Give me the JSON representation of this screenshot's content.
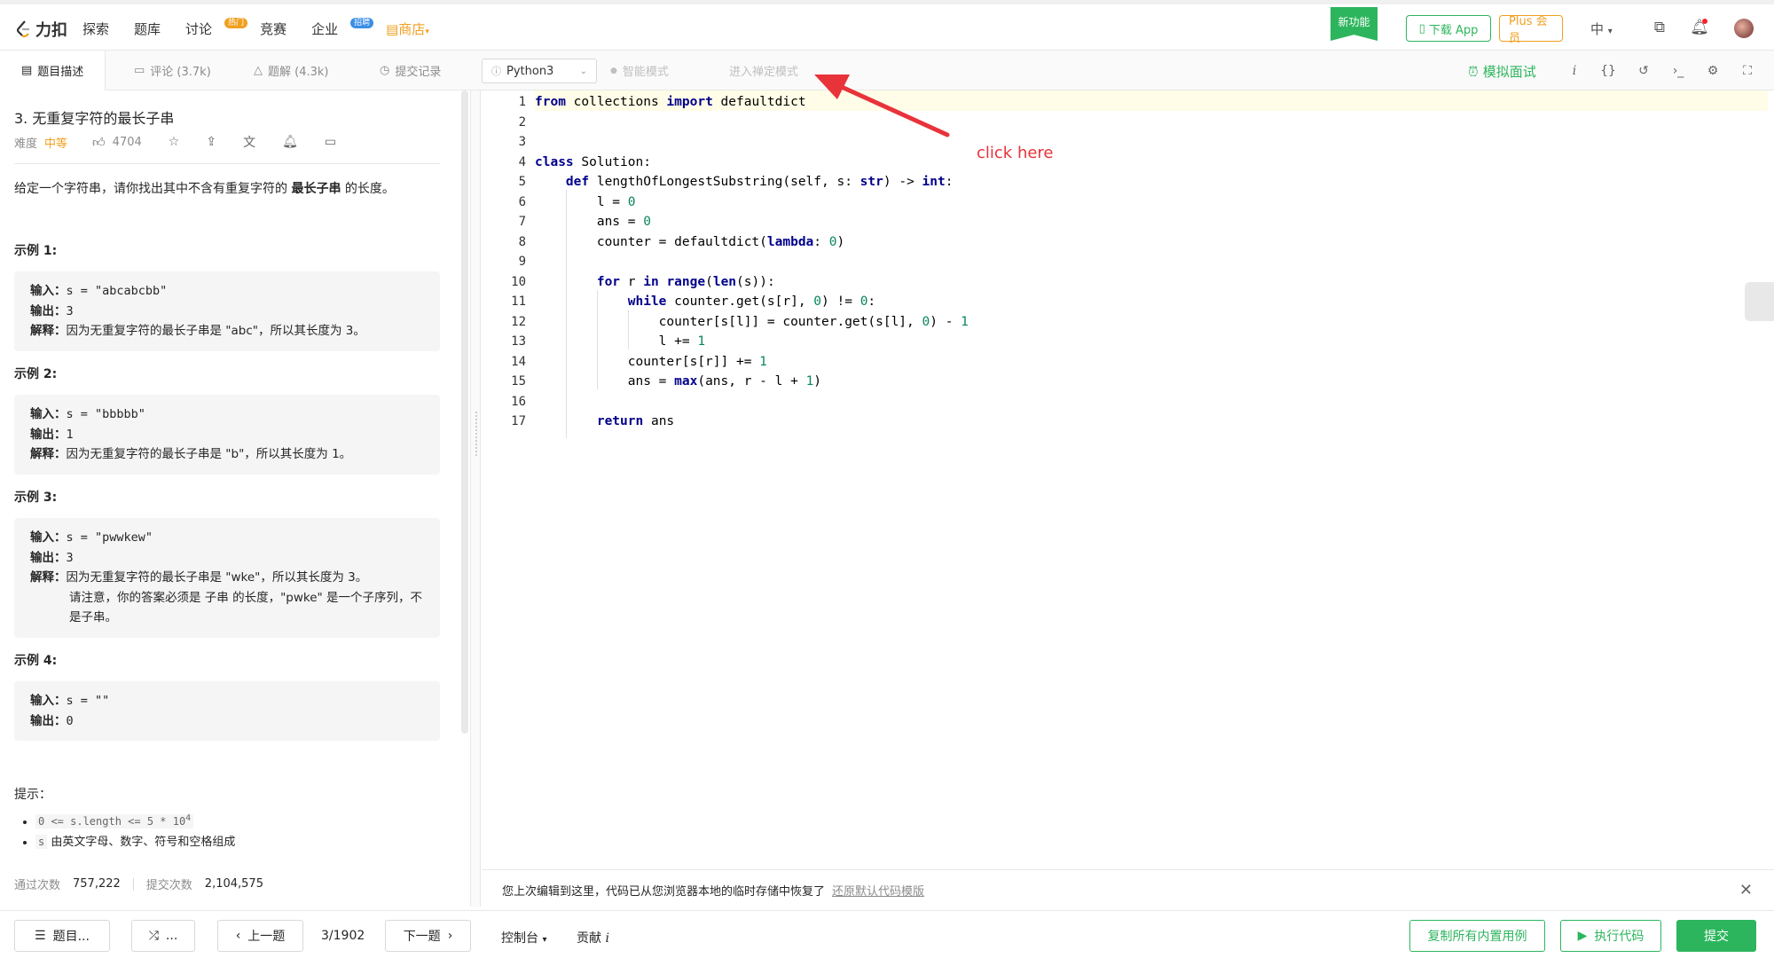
{
  "header": {
    "logo_text": "力扣",
    "nav": [
      {
        "label": "探索"
      },
      {
        "label": "题库"
      },
      {
        "label": "讨论",
        "badge": "热门"
      },
      {
        "label": "竞赛"
      },
      {
        "label": "企业",
        "badge": "招聘"
      },
      {
        "label": "商店"
      }
    ],
    "new_feature": "新功能",
    "download_app": "下载 App",
    "plus": "Plus 会员",
    "language": "中"
  },
  "tabs": {
    "description": "题目描述",
    "comments": "评论 (3.7k)",
    "solutions": "题解 (4.3k)",
    "submissions": "提交记录",
    "code_language": "Python3",
    "smart_mode": "智能模式",
    "zen_mode": "进入禅定模式",
    "mock_interview": "模拟面试"
  },
  "problem": {
    "title": "3. 无重复字符的最长子串",
    "difficulty_label": "难度",
    "difficulty": "中等",
    "likes": "4704",
    "description_pre": "给定一个字符串，请你找出其中不含有重复字符的 ",
    "description_bold": "最长子串",
    "description_post": " 的长度。",
    "examples": [
      {
        "title": "示例 1:",
        "input": "s = \"abcabcbb\"",
        "output": "3",
        "explain": "因为无重复字符的最长子串是 \"abc\"，所以其长度为 3。",
        "note": ""
      },
      {
        "title": "示例 2:",
        "input": "s = \"bbbbb\"",
        "output": "1",
        "explain": "因为无重复字符的最长子串是 \"b\"，所以其长度为 1。",
        "note": ""
      },
      {
        "title": "示例 3:",
        "input": "s = \"pwwkew\"",
        "output": "3",
        "explain": "因为无重复字符的最长子串是 \"wke\"，所以其长度为 3。",
        "note": "请注意，你的答案必须是 子串 的长度，\"pwke\" 是一个子序列，不是子串。"
      },
      {
        "title": "示例 4:",
        "input": "s = \"\"",
        "output": "0",
        "explain": "",
        "note": ""
      }
    ],
    "input_label": "输入：",
    "output_label": "输出：",
    "explain_label": "解释：",
    "hint_title": "提示：",
    "hint1_code": "0 <= s.length <= 5 * 10",
    "hint1_sup": "4",
    "hint2_code": "s",
    "hint2_text": " 由英文字母、数字、符号和空格组成",
    "accepted_label": "通过次数",
    "accepted": "757,222",
    "submitted_label": "提交次数",
    "submitted": "2,104,575"
  },
  "code": {
    "lines": [
      "from collections import defaultdict",
      "",
      "",
      "class Solution:",
      "    def lengthOfLongestSubstring(self, s: str) -> int:",
      "        l = 0",
      "        ans = 0",
      "        counter = defaultdict(lambda: 0)",
      "",
      "        for r in range(len(s)):",
      "            while counter.get(s[r], 0) != 0:",
      "                counter[s[l]] = counter.get(s[l], 0) - 1",
      "                l += 1",
      "            counter[s[r]] += 1",
      "            ans = max(ans, r - l + 1)",
      "",
      "        return ans"
    ]
  },
  "annotation": {
    "text": "click here",
    "color": "#e8333a"
  },
  "restore_bar": {
    "message": "您上次编辑到这里，代码已从您浏览器本地的临时存储中恢复了",
    "link": "还原默认代码模版"
  },
  "footer": {
    "problem_list": "题目...",
    "random": "...",
    "prev": "上一题",
    "page": "3/1902",
    "next": "下一题",
    "console": "控制台",
    "contribute": "贡献",
    "copy_cases": "复制所有内置用例",
    "run": "执行代码",
    "submit": "提交"
  },
  "colors": {
    "accent": "#2db55d",
    "orange": "#f0a020"
  }
}
